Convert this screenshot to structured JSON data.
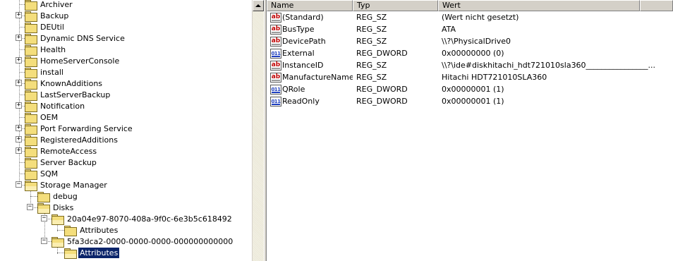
{
  "tree": {
    "items": [
      {
        "label": "Archiver"
      },
      {
        "label": "Backup"
      },
      {
        "label": "DEUtil"
      },
      {
        "label": "Dynamic DNS Service"
      },
      {
        "label": "Health"
      },
      {
        "label": "HomeServerConsole"
      },
      {
        "label": "install"
      },
      {
        "label": "KnownAdditions"
      },
      {
        "label": "LastServerBackup"
      },
      {
        "label": "Notification"
      },
      {
        "label": "OEM"
      },
      {
        "label": "Port Forwarding Service"
      },
      {
        "label": "RegisteredAdditions"
      },
      {
        "label": "RemoteAccess"
      },
      {
        "label": "Server Backup"
      },
      {
        "label": "SQM"
      },
      {
        "label": "Storage Manager"
      },
      {
        "label": "debug"
      },
      {
        "label": "Disks"
      },
      {
        "label": "20a04e97-8070-408a-9f0c-6e3b5c618492"
      },
      {
        "label": "Attributes"
      },
      {
        "label": "5fa3dca2-0000-0000-0000-000000000000"
      },
      {
        "label": "Attributes"
      }
    ],
    "expander_plus": "+",
    "expander_minus": "−"
  },
  "list": {
    "columns": {
      "name": "Name",
      "type": "Typ",
      "data": "Wert"
    },
    "rows": [
      {
        "name": "(Standard)",
        "type": "REG_SZ",
        "data": "(Wert nicht gesetzt)",
        "icon": "string-value-icon"
      },
      {
        "name": "BusType",
        "type": "REG_SZ",
        "data": "ATA",
        "icon": "string-value-icon"
      },
      {
        "name": "DevicePath",
        "type": "REG_SZ",
        "data": "\\\\?\\PhysicalDrive0",
        "icon": "string-value-icon"
      },
      {
        "name": "External",
        "type": "REG_DWORD",
        "data": "0x00000000 (0)",
        "icon": "binary-value-icon"
      },
      {
        "name": "InstanceID",
        "type": "REG_SZ",
        "data": "\\\\?\\ide#diskhitachi_hdt721010sla360________________...",
        "icon": "string-value-icon"
      },
      {
        "name": "ManufactureName",
        "type": "REG_SZ",
        "data": "Hitachi HDT721010SLA360",
        "icon": "string-value-icon"
      },
      {
        "name": "QRole",
        "type": "REG_DWORD",
        "data": "0x00000001 (1)",
        "icon": "binary-value-icon"
      },
      {
        "name": "ReadOnly",
        "type": "REG_DWORD",
        "data": "0x00000001 (1)",
        "icon": "binary-value-icon"
      }
    ],
    "icon_glyphs": {
      "sz": "ab",
      "dword": "011"
    }
  },
  "colors": {
    "selection": "#0a246a",
    "folder": "#f4de7c",
    "chrome": "#d4d0c8"
  }
}
